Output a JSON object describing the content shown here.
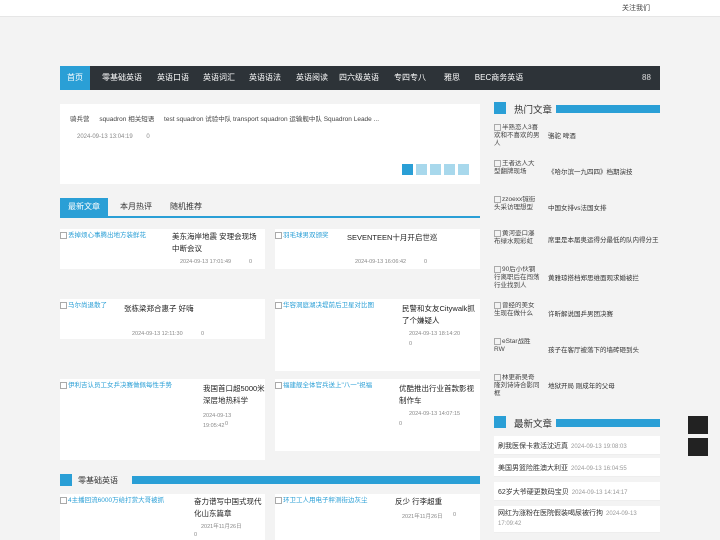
{
  "topbar": {
    "follow": "关注我们"
  },
  "nav": {
    "items": [
      "首页",
      "零基础英语",
      "英语口语",
      "英语词汇",
      "英语语法",
      "英语阅读",
      "四六级英语",
      "专四专八",
      "雅思",
      "BEC商务英语"
    ],
    "icon": "88"
  },
  "news": {
    "items": [
      "骑兵营",
      "squadron 相关短语",
      "test squadron 试验中队 transport squadron 运输舰中队 Squadron Leade ..."
    ],
    "date": "2024-09-13 13:04:19",
    "count": "0"
  },
  "tabs": [
    "最新文章",
    "本月热评",
    "随机推荐"
  ],
  "cards": [
    {
      "img": "丢掉烦心事腾出地方装鲜花",
      "title": "美东海岸地震 安理会现场中断会议",
      "date": "2024-09-13 17:01:49",
      "count": "0"
    },
    {
      "img": "羽毛球男双颁奖",
      "title": "SEVENTEEN十月开启世巡",
      "date": "2024-09-13 16:06:42",
      "count": "0"
    },
    {
      "img": "马尔尚退散了",
      "title": "张栋梁郑合惠子 好嗨",
      "date": "2024-09-13 12:11:30",
      "count": "0"
    },
    {
      "img": "华容洞庭湖决堤前后卫星对比图",
      "title": "民警和女友Citywalk抓了个嫌疑人",
      "date": "2024-09-13 18:14:20",
      "count": "0"
    },
    {
      "img": "伊利吉认员工女乒决赛做佩每性手势",
      "title": "我国首口超5000米深层地热科学",
      "date": "2024-09-13 19:05:42",
      "count": "0"
    },
    {
      "img": "福建舰全体官兵送上\"八一\"祝福",
      "title": "优酷推出行业首款影视制作车",
      "date": "2024-09-13 14:07:15",
      "count": "0"
    }
  ],
  "section": {
    "label": "零基础英语"
  },
  "bottom_cards": [
    {
      "img": "4主播回流6000万给打赏大哥被抓",
      "title": "奋力谱写中国式现代化山东篇章",
      "date": "2021年11月26日",
      "count": "0"
    },
    {
      "img": "环卫工人用电子秤测街边灰尘",
      "title": "反少 行李超重",
      "date": "2021年11月26日",
      "count": "0"
    }
  ],
  "sidebar": {
    "hot_title": "热门文章",
    "hot": [
      {
        "img": "半熟恋人3喜欢和不喜欢的男人",
        "title": "骆驼 啤酒"
      },
      {
        "img": "王者达人大型翻牌现场",
        "title": "《哈尔滨一九四四》档期演技"
      },
      {
        "img": "zzoexx铖街头采访理想型",
        "title": "中国女排vs法国女排"
      },
      {
        "img": "黄河壶口瀑布绿水观彩虹",
        "title": "席里是本届奥运得分最低的队内得分王"
      },
      {
        "img": "90后小伙钢行离职后在闯荡行业找到人",
        "title": "黄雅琼搭档郑思维面观求婚被拦"
      },
      {
        "img": "曾经的美女生现在做什么",
        "title": "许昕解说国乒男团决赛"
      },
      {
        "img": "eStar战胜RW",
        "title": "孩子在客厅被落下的墙砖砸到头"
      },
      {
        "img": "林更新吴奇隆刘诗诗合影同框",
        "title": "地狱开局 刚成年的父母"
      }
    ],
    "new_title": "最新文章",
    "new": [
      {
        "title": "刷我医保卡救活沈近真",
        "date": "2024-09-13 19:08:03"
      },
      {
        "title": "美国男篮险胜澳大利亚",
        "date": "2024-09-13 16:04:55"
      },
      {
        "title": "62岁大爷硬更数码宝贝",
        "date": "2024-09-13 14:14:17"
      },
      {
        "title": "网红为涨粉在医院假装喝尿被行拘",
        "date": "2024-09-13 17:09:42"
      }
    ]
  }
}
